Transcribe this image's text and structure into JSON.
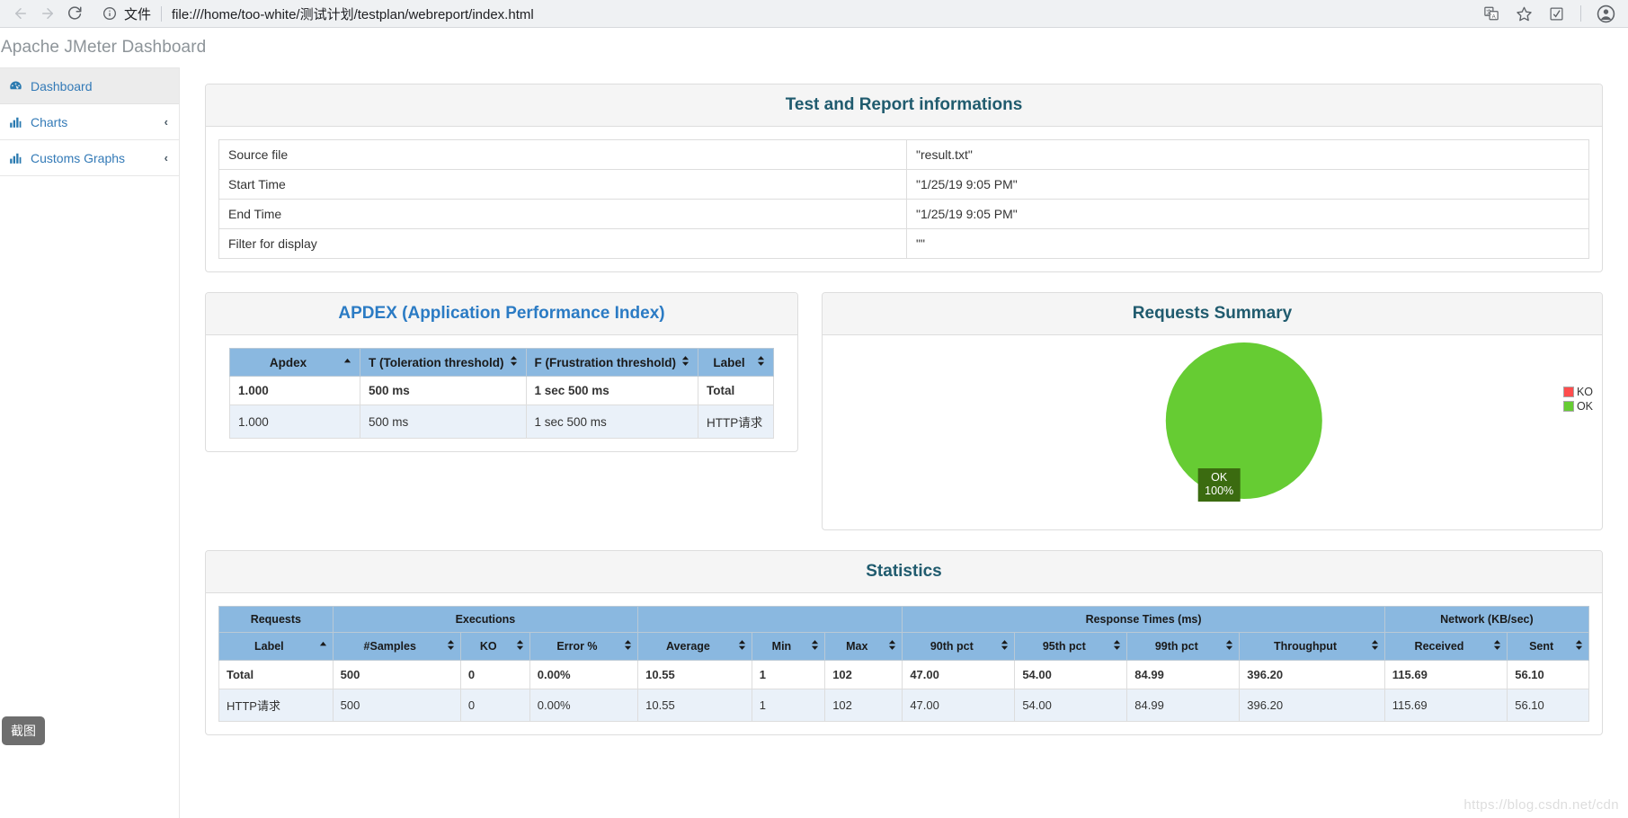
{
  "browser": {
    "back_icon": "back-arrow-icon",
    "forward_icon": "forward-arrow-icon",
    "reload_icon": "reload-icon",
    "info_icon": "info-circle-icon",
    "file_label": "文件",
    "url": "file:///home/too-white/测试计划/testplan/webreport/index.html",
    "toolbar_icons": [
      "translate-icon",
      "bookmark-star-icon",
      "extension-icon",
      "profile-icon"
    ]
  },
  "page": {
    "title": "Apache JMeter Dashboard",
    "watermark": "https://blog.csdn.net/cdn"
  },
  "sidebar": {
    "items": [
      {
        "label": "Dashboard",
        "icon": "dashboard-gauge-icon",
        "chevron": "",
        "active": true
      },
      {
        "label": "Charts",
        "icon": "bar-chart-icon",
        "chevron": "‹",
        "active": false
      },
      {
        "label": "Customs Graphs",
        "icon": "bar-chart-icon",
        "chevron": "‹",
        "active": false
      }
    ]
  },
  "test_info": {
    "title": "Test and Report informations",
    "rows": [
      {
        "key": "Source file",
        "value": "\"result.txt\""
      },
      {
        "key": "Start Time",
        "value": "\"1/25/19 9:05 PM\""
      },
      {
        "key": "End Time",
        "value": "\"1/25/19 9:05 PM\""
      },
      {
        "key": "Filter for display",
        "value": "\"\""
      }
    ]
  },
  "apdex": {
    "title": "APDEX (Application Performance Index)",
    "columns": [
      "Apdex",
      "T (Toleration threshold)",
      "F (Frustration threshold)",
      "Label"
    ],
    "sort_state": [
      "asc",
      "both",
      "both",
      "both"
    ],
    "rows": [
      {
        "apdex": "1.000",
        "t": "500 ms",
        "f": "1 sec 500 ms",
        "label": "Total",
        "total": true
      },
      {
        "apdex": "1.000",
        "t": "500 ms",
        "f": "1 sec 500 ms",
        "label": "HTTP请求",
        "total": false
      }
    ]
  },
  "requests_summary": {
    "title": "Requests Summary",
    "legend": [
      {
        "label": "KO",
        "color": "#ff4d4d"
      },
      {
        "label": "OK",
        "color": "#66cc33"
      }
    ],
    "tooltip": {
      "line1": "OK",
      "line2": "100%"
    },
    "chart_data": {
      "type": "pie",
      "title": "Requests Summary",
      "categories": [
        "KO",
        "OK"
      ],
      "values": [
        0,
        100
      ],
      "unit": "%",
      "colors": [
        "#ff4d4d",
        "#66cc33"
      ],
      "legend_position": "right",
      "labels": [
        "OK 100%"
      ]
    }
  },
  "statistics": {
    "title": "Statistics",
    "group_headers": [
      {
        "label": "Requests",
        "span": 1
      },
      {
        "label": "Executions",
        "span": 3
      },
      {
        "label": "",
        "span": 3
      },
      {
        "label": "Response Times (ms)",
        "span": 5
      },
      {
        "label": "Network (KB/sec)",
        "span": 2
      }
    ],
    "columns": [
      "Label",
      "#Samples",
      "KO",
      "Error %",
      "Average",
      "Min",
      "Max",
      "90th pct",
      "95th pct",
      "99th pct",
      "Throughput",
      "Received",
      "Sent"
    ],
    "sort_state": [
      "asc",
      "both",
      "both",
      "both",
      "both",
      "both",
      "both",
      "both",
      "both",
      "both",
      "both",
      "both",
      "both"
    ],
    "rows": [
      {
        "total": true,
        "cells": [
          "Total",
          "500",
          "0",
          "0.00%",
          "10.55",
          "1",
          "102",
          "47.00",
          "54.00",
          "84.99",
          "396.20",
          "115.69",
          "56.10"
        ]
      },
      {
        "total": false,
        "cells": [
          "HTTP请求",
          "500",
          "0",
          "0.00%",
          "10.55",
          "1",
          "102",
          "47.00",
          "54.00",
          "84.99",
          "396.20",
          "115.69",
          "56.10"
        ]
      }
    ]
  },
  "screenshot_button": {
    "label": "截图"
  }
}
